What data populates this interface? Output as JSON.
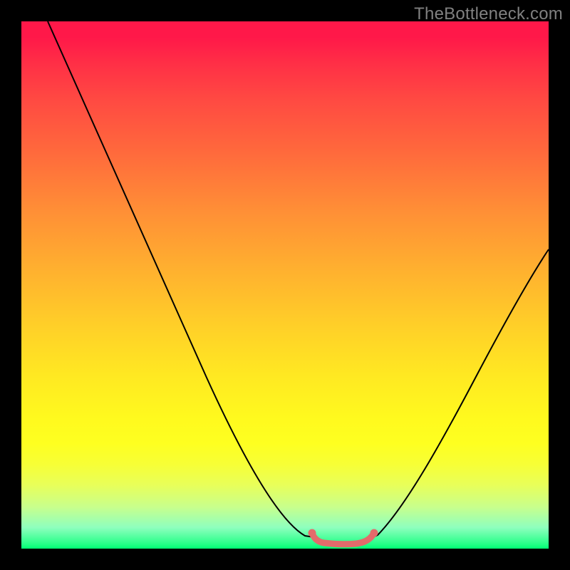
{
  "watermark": "TheBottleneck.com",
  "chart_data": {
    "type": "line",
    "title": "",
    "xlabel": "",
    "ylabel": "",
    "xlim": [
      0,
      100
    ],
    "ylim": [
      0,
      100
    ],
    "series": [
      {
        "name": "left-curve",
        "x": [
          5,
          10,
          15,
          20,
          25,
          30,
          35,
          40,
          45,
          50,
          53,
          55.5
        ],
        "y": [
          100,
          92,
          83,
          73,
          63,
          53,
          42.5,
          32,
          22,
          12.5,
          6.5,
          2.2
        ]
      },
      {
        "name": "valley-floor",
        "x": [
          55.5,
          57,
          60,
          63,
          65,
          67
        ],
        "y": [
          2.2,
          1.4,
          1.2,
          1.3,
          1.6,
          2.4
        ]
      },
      {
        "name": "right-curve",
        "x": [
          67,
          70,
          75,
          80,
          85,
          90,
          95,
          100
        ],
        "y": [
          2.4,
          7.5,
          16.5,
          25,
          33,
          40.5,
          47.5,
          54
        ]
      }
    ],
    "annotations": [
      {
        "name": "valley-highlight",
        "x_range": [
          55.5,
          67
        ],
        "y": 2,
        "color": "#e36b6b"
      }
    ],
    "gradient_stops": [
      {
        "pos": 0,
        "color": "#ff1849"
      },
      {
        "pos": 50,
        "color": "#ffb02f"
      },
      {
        "pos": 75,
        "color": "#fff91e"
      },
      {
        "pos": 100,
        "color": "#00ff73"
      }
    ]
  },
  "colors": {
    "curve": "#000000",
    "highlight": "#e36b6b",
    "watermark": "#808080",
    "frame": "#000000"
  }
}
